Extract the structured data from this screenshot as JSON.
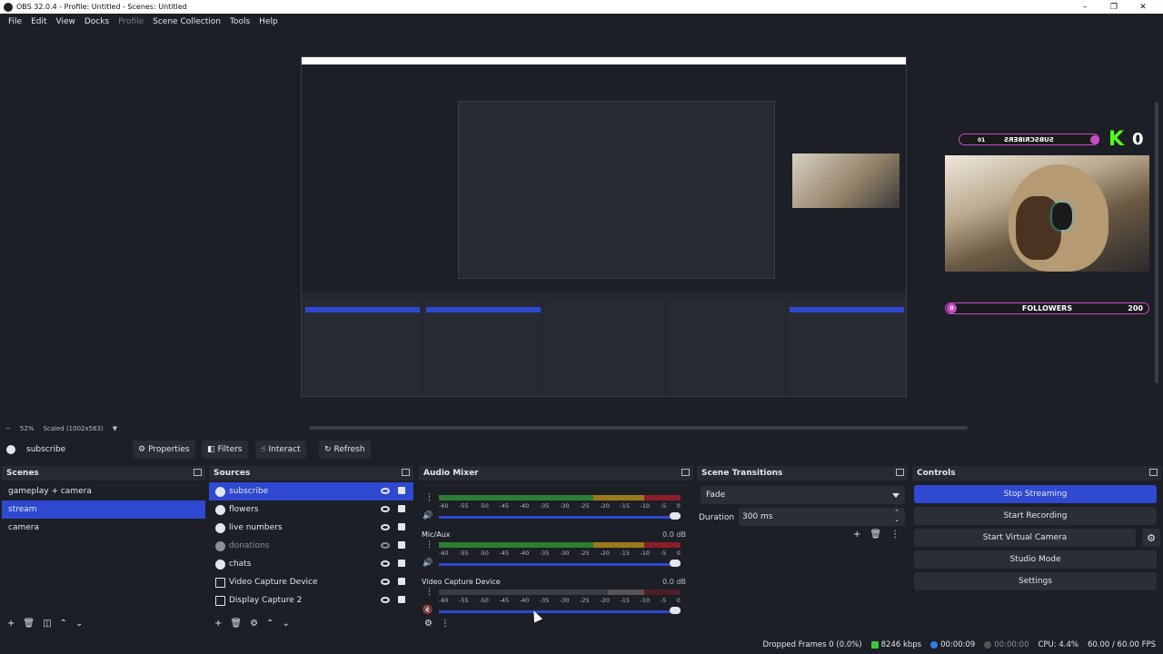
{
  "window": {
    "title": "OBS 32.0.4 - Profile: Untitled - Scenes: Untitled",
    "controls": [
      "–",
      "❐",
      "✕"
    ]
  },
  "menu": [
    "File",
    "Edit",
    "View",
    "Docks",
    "Profile",
    "Scene Collection",
    "Tools",
    "Help"
  ],
  "preview": {
    "overlay": {
      "subscribe_label": "SUBSCRIBERS",
      "subscribe_count": "01",
      "kick_letter": "K",
      "kick_count": "0",
      "followers_label": "FOLLOWERS",
      "followers_count": "200",
      "followers_start": "0"
    }
  },
  "zoom": {
    "minus": "−",
    "level": "52%",
    "mode": "Scaled (1002x563)"
  },
  "context": {
    "source_name": "subscribe",
    "buttons": {
      "properties": "Properties",
      "filters": "Filters",
      "interact": "Interact",
      "refresh": "Refresh"
    }
  },
  "scenes": {
    "title": "Scenes",
    "items": [
      "gameplay + camera",
      "stream",
      "camera"
    ],
    "selected_index": 1
  },
  "sources": {
    "title": "Sources",
    "items": [
      {
        "name": "subscribe",
        "icon": "browser-icon",
        "selected": true
      },
      {
        "name": "flowers",
        "icon": "browser-icon"
      },
      {
        "name": "live numbers",
        "icon": "browser-icon"
      },
      {
        "name": "donations",
        "icon": "browser-icon",
        "hidden": true
      },
      {
        "name": "chats",
        "icon": "browser-icon"
      },
      {
        "name": "Video Capture Device",
        "icon": "camera-icon"
      },
      {
        "name": "Display Capture 2",
        "icon": "monitor-icon"
      }
    ]
  },
  "audio": {
    "title": "Audio Mixer",
    "scale": [
      "-60",
      "-55",
      "-50",
      "-45",
      "-40",
      "-35",
      "-30",
      "-25",
      "-20",
      "-15",
      "-10",
      "-5",
      "0"
    ],
    "channels": [
      {
        "name": "",
        "db": ""
      },
      {
        "name": "Mic/Aux",
        "db": "0.0 dB"
      },
      {
        "name": "Video Capture Device",
        "db": "0.0 dB"
      }
    ]
  },
  "transitions": {
    "title": "Scene Transitions",
    "selected": "Fade",
    "duration_label": "Duration",
    "duration_value": "300 ms"
  },
  "controls": {
    "title": "Controls",
    "buttons": [
      "Stop Streaming",
      "Start Recording",
      "Start Virtual Camera",
      "Studio Mode",
      "Settings"
    ]
  },
  "status": {
    "dropped_frames": "Dropped Frames 0 (0.0%)",
    "bitrate": "8246 kbps",
    "stream_time": "00:00:09",
    "record_time": "00:00:00",
    "cpu": "CPU: 4.4%",
    "fps": "60.00 / 60.00 FPS"
  },
  "colors": {
    "accent": "#2f49d1",
    "bg": "#1d1f26",
    "panel": "#272a33",
    "kick_green": "#53fc18",
    "overlay_pink": "#c84cc8"
  }
}
